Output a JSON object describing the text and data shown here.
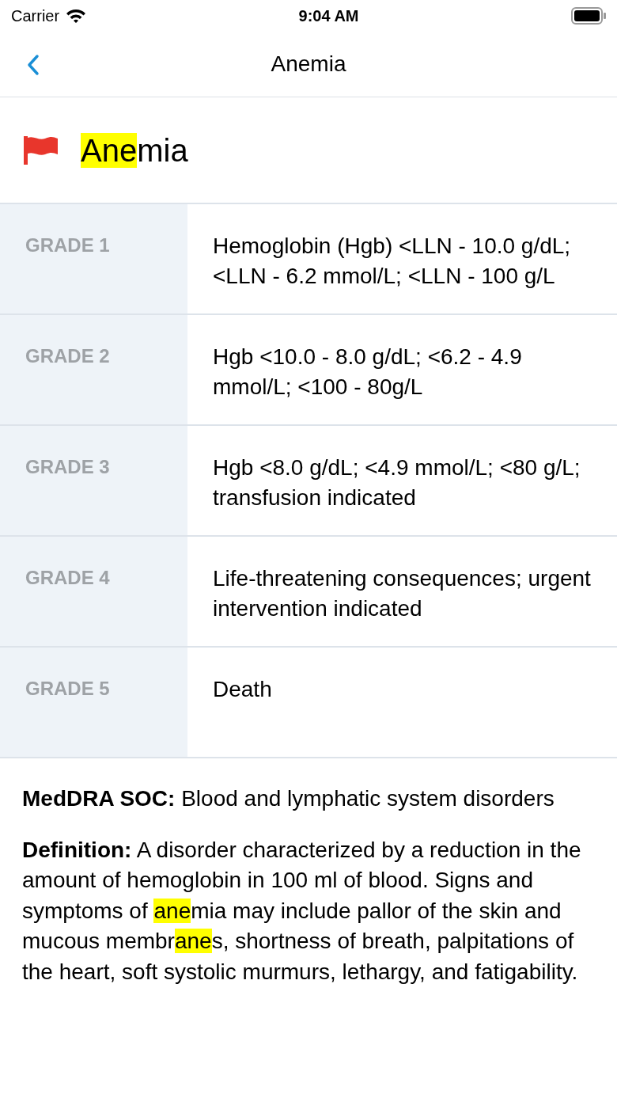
{
  "status_bar": {
    "carrier": "Carrier",
    "time": "9:04 AM"
  },
  "nav": {
    "title": "Anemia"
  },
  "term": {
    "title": [
      {
        "text": "Ane",
        "highlight": true
      },
      {
        "text": "mia",
        "highlight": false
      }
    ]
  },
  "grades": [
    {
      "label": "GRADE 1",
      "text": "Hemoglobin (Hgb) <LLN - 10.0 g/dL; <LLN - 6.2 mmol/L; <LLN - 100 g/L"
    },
    {
      "label": "GRADE 2",
      "text": "Hgb <10.0 - 8.0 g/dL; <6.2 - 4.9 mmol/L; <100 - 80g/L"
    },
    {
      "label": "GRADE 3",
      "text": "Hgb <8.0 g/dL; <4.9 mmol/L; <80 g/L; transfusion indicated"
    },
    {
      "label": "GRADE 4",
      "text": "Life-threatening consequences; urgent intervention indicated"
    },
    {
      "label": "GRADE 5",
      "text": "Death"
    }
  ],
  "details": [
    {
      "label": "MedDRA SOC:",
      "segments": [
        {
          "text": " Blood and lymphatic system disorders",
          "highlight": false
        }
      ]
    },
    {
      "label": "Definition:",
      "segments": [
        {
          "text": " A disorder characterized by a reduction in the amount of hemoglobin in 100 ml of blood. Signs and symptoms of ",
          "highlight": false
        },
        {
          "text": "ane",
          "highlight": true
        },
        {
          "text": "mia may include pallor of the skin and mucous membr",
          "highlight": false
        },
        {
          "text": "ane",
          "highlight": true
        },
        {
          "text": "s, shortness of breath, palpitations of the heart, soft systolic murmurs, lethargy, and fatigability.",
          "highlight": false
        }
      ]
    }
  ]
}
